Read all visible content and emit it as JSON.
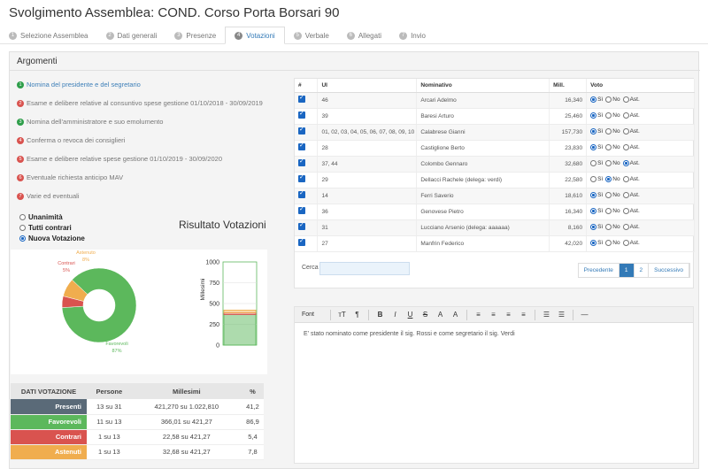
{
  "page": {
    "title": "Svolgimento Assemblea: COND. Corso Porta Borsari 90"
  },
  "steps": [
    {
      "num": "1",
      "label": "Selezione Assemblea"
    },
    {
      "num": "2",
      "label": "Dati generali"
    },
    {
      "num": "3",
      "label": "Presenze"
    },
    {
      "num": "4",
      "label": "Votazioni"
    },
    {
      "num": "5",
      "label": "Verbale"
    },
    {
      "num": "6",
      "label": "Allegati"
    },
    {
      "num": "7",
      "label": "Invio"
    }
  ],
  "argomenti": {
    "header": "Argomenti",
    "items": [
      {
        "num": "1",
        "label": "Nomina del presidente e del segretario",
        "status": "green"
      },
      {
        "num": "2",
        "label": "Esame e delibere relative al consuntivo spese gestione 01/10/2018 - 30/09/2019",
        "status": "red"
      },
      {
        "num": "3",
        "label": "Nomina dell'amministratore e suo emolumento",
        "status": "green"
      },
      {
        "num": "4",
        "label": "Conferma o revoca dei consiglieri",
        "status": "red"
      },
      {
        "num": "5",
        "label": "Esame e delibere relative spese gestione 01/10/2019 - 30/09/2020",
        "status": "red"
      },
      {
        "num": "6",
        "label": "Eventuale richiesta anticipo MAV",
        "status": "red"
      },
      {
        "num": "7",
        "label": "Varie ed eventuali",
        "status": "red"
      }
    ]
  },
  "risultato": {
    "title": "Risultato Votazioni",
    "options": [
      "Unanimità",
      "Tutti contrari",
      "Nuova Votazione"
    ],
    "selected": 2
  },
  "chart_data": [
    {
      "type": "pie",
      "categories": [
        "Favorevoli",
        "Contrari",
        "Astenuti"
      ],
      "values": [
        87,
        5,
        8
      ],
      "labels": [
        "Favorevoli\n87%",
        "Contrari\n5%",
        "Astenuto\n8%"
      ],
      "colors": [
        "#5cb85c",
        "#d9534f",
        "#f0ad4e"
      ]
    },
    {
      "type": "bar",
      "ylabel": "Millesimi",
      "ylim": [
        0,
        1000
      ],
      "yticks": [
        "0",
        "250",
        "500",
        "750",
        "1000"
      ],
      "series": [
        {
          "values": [
            366.01
          ],
          "color": "#5cb85c"
        },
        {
          "values": [
            22.58
          ],
          "color": "#d9534f"
        },
        {
          "values": [
            32.68
          ],
          "color": "#f0ad4e"
        }
      ]
    }
  ],
  "dati": {
    "headers": [
      "DATI VOTAZIONE",
      "Persone",
      "Millesimi",
      "%"
    ],
    "rows": [
      {
        "label": "Presenti",
        "persone": "13 su 31",
        "millesimi": "421,270 su 1.022,810",
        "pct": "41,2",
        "color": "#5a6a78"
      },
      {
        "label": "Favorevoli",
        "persone": "11 su 13",
        "millesimi": "366,01 su 421,27",
        "pct": "86,9",
        "color": "#5cb85c"
      },
      {
        "label": "Contrari",
        "persone": "1 su 13",
        "millesimi": "22,58 su 421,27",
        "pct": "5,4",
        "color": "#d9534f"
      },
      {
        "label": "Astenuti",
        "persone": "1 su 13",
        "millesimi": "32,68 su 421,27",
        "pct": "7,8",
        "color": "#f0ad4e"
      }
    ]
  },
  "grid": {
    "headers": [
      "#",
      "UI",
      "Nominativo",
      "Mill.",
      "Voto"
    ],
    "vote_labels": [
      "Sì",
      "No",
      "Ast."
    ],
    "rows": [
      {
        "ui": "46",
        "nome": "Arcari Adelmo",
        "mill": "16,340",
        "voto": 0
      },
      {
        "ui": "39",
        "nome": "Baresi Arturo",
        "mill": "25,460",
        "voto": 0
      },
      {
        "ui": "01, 02, 03, 04, 05, 06, 07, 08, 09, 10",
        "nome": "Calabrese Gianni",
        "mill": "157,730",
        "voto": 0
      },
      {
        "ui": "28",
        "nome": "Castiglione Berto",
        "mill": "23,830",
        "voto": 0
      },
      {
        "ui": "37, 44",
        "nome": "Colombo Gennaro",
        "mill": "32,680",
        "voto": 2
      },
      {
        "ui": "29",
        "nome": "Dellacci Rachele (delega: verdi)",
        "mill": "22,580",
        "voto": 1
      },
      {
        "ui": "14",
        "nome": "Ferri Saverio",
        "mill": "18,610",
        "voto": 0
      },
      {
        "ui": "36",
        "nome": "Genovese Pietro",
        "mill": "16,340",
        "voto": 0
      },
      {
        "ui": "31",
        "nome": "Lucciano Arsenio (delega: aaaaaa)",
        "mill": "8,160",
        "voto": 0
      },
      {
        "ui": "27",
        "nome": "Manfrin Federico",
        "mill": "42,020",
        "voto": 0
      }
    ],
    "search_label": "Cerca",
    "search_value": "",
    "pager": {
      "prev": "Precedente",
      "p1": "1",
      "p2": "2",
      "next": "Successivo"
    }
  },
  "editor": {
    "toolbar": [
      "Font",
      "ᴛT",
      "¶",
      "B",
      "I",
      "U",
      "S",
      "A",
      "A",
      "≡",
      "≡",
      "≡",
      "≡",
      "☰",
      "☰",
      "—"
    ],
    "text": "E' stato nominato come presidente il sig. Rossi e come segretario il sig. Verdi"
  }
}
